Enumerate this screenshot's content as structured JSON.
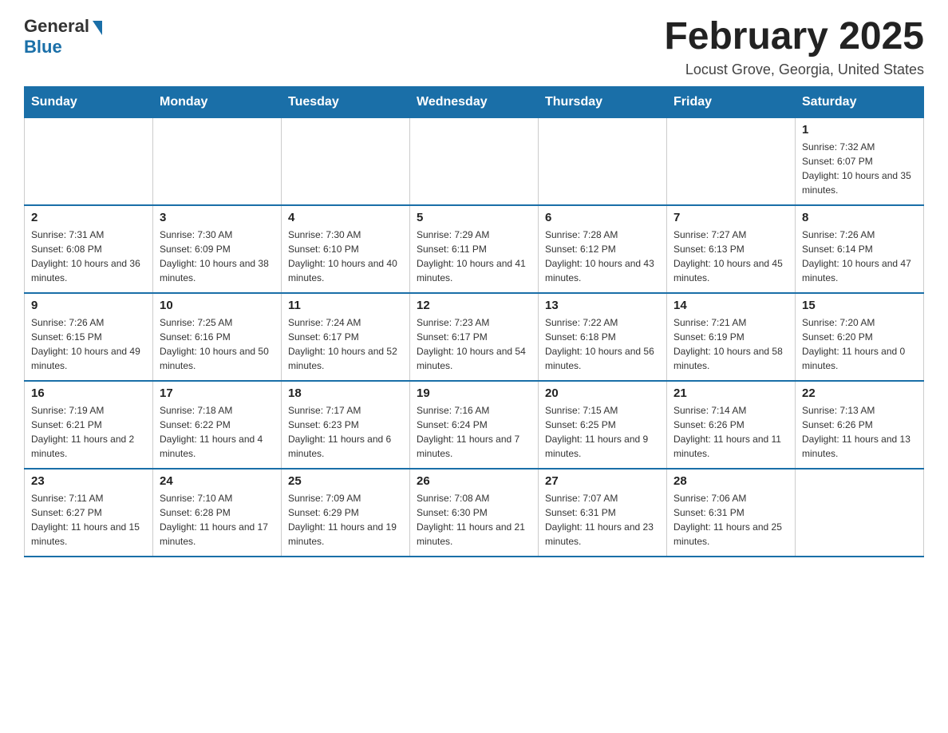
{
  "logo": {
    "general": "General",
    "blue": "Blue"
  },
  "header": {
    "month_year": "February 2025",
    "location": "Locust Grove, Georgia, United States"
  },
  "weekdays": [
    "Sunday",
    "Monday",
    "Tuesday",
    "Wednesday",
    "Thursday",
    "Friday",
    "Saturday"
  ],
  "weeks": [
    [
      {
        "day": "",
        "info": ""
      },
      {
        "day": "",
        "info": ""
      },
      {
        "day": "",
        "info": ""
      },
      {
        "day": "",
        "info": ""
      },
      {
        "day": "",
        "info": ""
      },
      {
        "day": "",
        "info": ""
      },
      {
        "day": "1",
        "info": "Sunrise: 7:32 AM\nSunset: 6:07 PM\nDaylight: 10 hours and 35 minutes."
      }
    ],
    [
      {
        "day": "2",
        "info": "Sunrise: 7:31 AM\nSunset: 6:08 PM\nDaylight: 10 hours and 36 minutes."
      },
      {
        "day": "3",
        "info": "Sunrise: 7:30 AM\nSunset: 6:09 PM\nDaylight: 10 hours and 38 minutes."
      },
      {
        "day": "4",
        "info": "Sunrise: 7:30 AM\nSunset: 6:10 PM\nDaylight: 10 hours and 40 minutes."
      },
      {
        "day": "5",
        "info": "Sunrise: 7:29 AM\nSunset: 6:11 PM\nDaylight: 10 hours and 41 minutes."
      },
      {
        "day": "6",
        "info": "Sunrise: 7:28 AM\nSunset: 6:12 PM\nDaylight: 10 hours and 43 minutes."
      },
      {
        "day": "7",
        "info": "Sunrise: 7:27 AM\nSunset: 6:13 PM\nDaylight: 10 hours and 45 minutes."
      },
      {
        "day": "8",
        "info": "Sunrise: 7:26 AM\nSunset: 6:14 PM\nDaylight: 10 hours and 47 minutes."
      }
    ],
    [
      {
        "day": "9",
        "info": "Sunrise: 7:26 AM\nSunset: 6:15 PM\nDaylight: 10 hours and 49 minutes."
      },
      {
        "day": "10",
        "info": "Sunrise: 7:25 AM\nSunset: 6:16 PM\nDaylight: 10 hours and 50 minutes."
      },
      {
        "day": "11",
        "info": "Sunrise: 7:24 AM\nSunset: 6:17 PM\nDaylight: 10 hours and 52 minutes."
      },
      {
        "day": "12",
        "info": "Sunrise: 7:23 AM\nSunset: 6:17 PM\nDaylight: 10 hours and 54 minutes."
      },
      {
        "day": "13",
        "info": "Sunrise: 7:22 AM\nSunset: 6:18 PM\nDaylight: 10 hours and 56 minutes."
      },
      {
        "day": "14",
        "info": "Sunrise: 7:21 AM\nSunset: 6:19 PM\nDaylight: 10 hours and 58 minutes."
      },
      {
        "day": "15",
        "info": "Sunrise: 7:20 AM\nSunset: 6:20 PM\nDaylight: 11 hours and 0 minutes."
      }
    ],
    [
      {
        "day": "16",
        "info": "Sunrise: 7:19 AM\nSunset: 6:21 PM\nDaylight: 11 hours and 2 minutes."
      },
      {
        "day": "17",
        "info": "Sunrise: 7:18 AM\nSunset: 6:22 PM\nDaylight: 11 hours and 4 minutes."
      },
      {
        "day": "18",
        "info": "Sunrise: 7:17 AM\nSunset: 6:23 PM\nDaylight: 11 hours and 6 minutes."
      },
      {
        "day": "19",
        "info": "Sunrise: 7:16 AM\nSunset: 6:24 PM\nDaylight: 11 hours and 7 minutes."
      },
      {
        "day": "20",
        "info": "Sunrise: 7:15 AM\nSunset: 6:25 PM\nDaylight: 11 hours and 9 minutes."
      },
      {
        "day": "21",
        "info": "Sunrise: 7:14 AM\nSunset: 6:26 PM\nDaylight: 11 hours and 11 minutes."
      },
      {
        "day": "22",
        "info": "Sunrise: 7:13 AM\nSunset: 6:26 PM\nDaylight: 11 hours and 13 minutes."
      }
    ],
    [
      {
        "day": "23",
        "info": "Sunrise: 7:11 AM\nSunset: 6:27 PM\nDaylight: 11 hours and 15 minutes."
      },
      {
        "day": "24",
        "info": "Sunrise: 7:10 AM\nSunset: 6:28 PM\nDaylight: 11 hours and 17 minutes."
      },
      {
        "day": "25",
        "info": "Sunrise: 7:09 AM\nSunset: 6:29 PM\nDaylight: 11 hours and 19 minutes."
      },
      {
        "day": "26",
        "info": "Sunrise: 7:08 AM\nSunset: 6:30 PM\nDaylight: 11 hours and 21 minutes."
      },
      {
        "day": "27",
        "info": "Sunrise: 7:07 AM\nSunset: 6:31 PM\nDaylight: 11 hours and 23 minutes."
      },
      {
        "day": "28",
        "info": "Sunrise: 7:06 AM\nSunset: 6:31 PM\nDaylight: 11 hours and 25 minutes."
      },
      {
        "day": "",
        "info": ""
      }
    ]
  ]
}
